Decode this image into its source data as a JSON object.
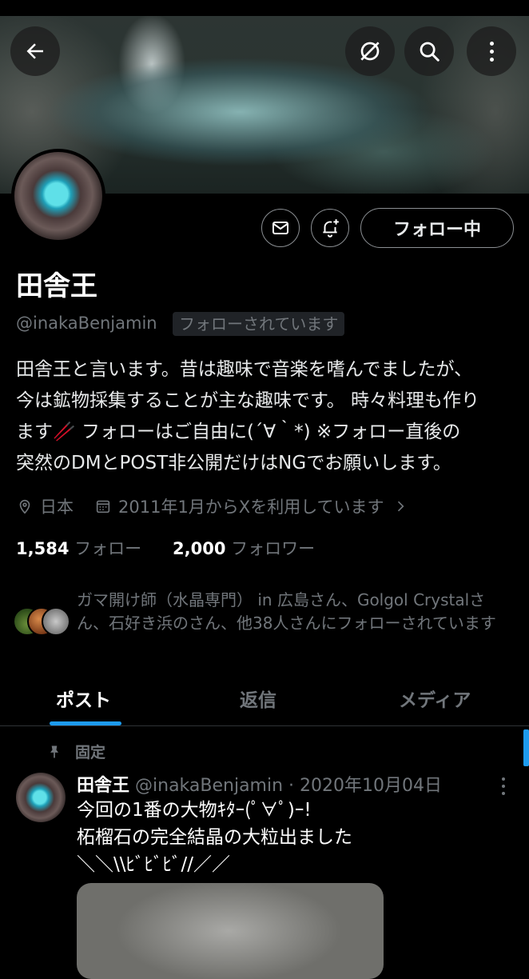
{
  "header": {
    "back_icon": "arrow-left-icon",
    "grok_icon": "grok-slash-circle-icon",
    "search_icon": "search-icon",
    "more_icon": "more-vertical-icon"
  },
  "profile": {
    "name": "田舎王",
    "handle": "@inakaBenjamin",
    "follows_you": "フォローされています",
    "follow_button": "フォロー中",
    "bio": "田舎王と言います。昔は趣味で音楽を嗜んでましたが、\n今は鉱物採集することが主な趣味です。 時々料理も作り\nます🥢 フォローはご自由に(´∀｀*) ※フォロー直後の\n突然のDMとPOST非公開だけはNGでお願いします。",
    "location": "日本",
    "joined": "2011年1月からXを利用しています",
    "following_count": "1,584",
    "following_label": "フォロー",
    "followers_count": "2,000",
    "followers_label": "フォロワー",
    "followed_by": "ガマ開け師（水晶専門） in 広島さん、Golgol Crystalさん、石好き浜のさん、他38人さんにフォローされています"
  },
  "tabs": [
    {
      "label": "ポスト",
      "active": true
    },
    {
      "label": "返信",
      "active": false
    },
    {
      "label": "メディア",
      "active": false
    }
  ],
  "pinned_tweet": {
    "pinned_label": "固定",
    "author_name": "田舎王",
    "meta": "@inakaBenjamin · 2020年10月04日",
    "text": "今回の1番の大物ｷﾀｰ(ﾟ∀ﾟ)ｰ!\n柘榴石の完全結晶の大粒出ました\n＼＼\\\\ﾋﾞﾋﾞﾋﾞ//／／"
  },
  "colors": {
    "accent": "#1d9bf0",
    "secondary_text": "#71767b",
    "background": "#000000"
  }
}
